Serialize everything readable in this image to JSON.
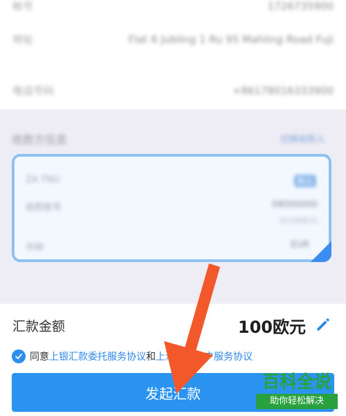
{
  "sender": {
    "rows": [
      {
        "label": "帐号",
        "value": "1726735900"
      },
      {
        "label": "地址",
        "value": "Flat 6 Jubling 1 Ru 95 Mahling Road Fuji"
      },
      {
        "label": "电话号码",
        "value": "+86178016333900"
      }
    ]
  },
  "receiver": {
    "title": "收款方信息",
    "switch_label": "切换收款人",
    "card": {
      "name": "ZA TNU",
      "badge": "默认",
      "account_label": "收款账号",
      "account_number": "08000000",
      "account_sub": "32190831",
      "currency_label": "币种",
      "currency_value": "EUR"
    }
  },
  "amount": {
    "label": "汇款金额",
    "value": "100欧元"
  },
  "agreement": {
    "prefix": "同意",
    "link1": "上银汇款委托服务协议",
    "middle": "和",
    "link2": "上海银行客户服务协议"
  },
  "submit_label": "发起汇款",
  "watermark": {
    "brand": "百科全说",
    "slogan": "助你轻松解决"
  },
  "colors": {
    "primary": "#2b93f0",
    "arrow": "#f2582a",
    "watermark": "#2aa13f"
  }
}
